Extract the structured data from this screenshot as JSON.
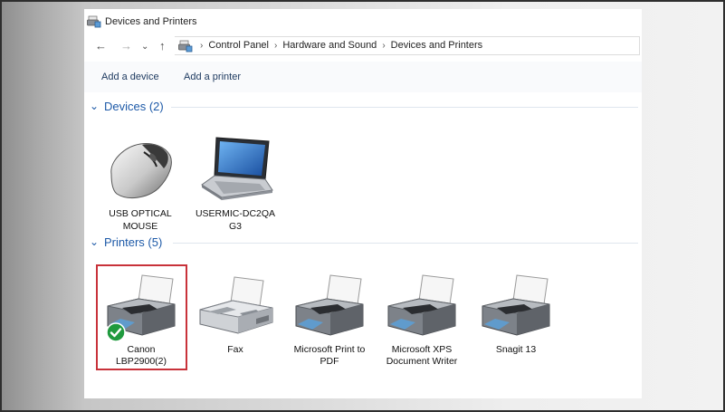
{
  "window": {
    "title": "Devices and Printers"
  },
  "nav": {
    "back": "←",
    "forward": "→",
    "recent": "⌄",
    "up": "↑"
  },
  "breadcrumb": [
    "Control Panel",
    "Hardware and Sound",
    "Devices and Printers"
  ],
  "breadcrumb_separator": "›",
  "toolbar": {
    "add_device": "Add a device",
    "add_printer": "Add a printer"
  },
  "devices_group": {
    "header": "Devices (2)",
    "items": [
      {
        "line1": "USB OPTICAL",
        "line2": "MOUSE",
        "icon": "mouse-icon"
      },
      {
        "line1": "USERMIC-DC2QA",
        "line2": "G3",
        "icon": "laptop-icon"
      }
    ]
  },
  "printers_group": {
    "header": "Printers (5)",
    "items": [
      {
        "line1": "Canon",
        "line2": "LBP2900(2)",
        "icon": "printer-icon",
        "default": true,
        "selected": true
      },
      {
        "line1": "Fax",
        "line2": "",
        "icon": "fax-icon"
      },
      {
        "line1": "Microsoft Print to",
        "line2": "PDF",
        "icon": "printer-icon"
      },
      {
        "line1": "Microsoft XPS",
        "line2": "Document Writer",
        "icon": "printer-icon"
      },
      {
        "line1": "Snagit 13",
        "line2": "",
        "icon": "printer-icon"
      }
    ]
  },
  "colors": {
    "group_header": "#1e5aa8",
    "selection_border": "#c8323a",
    "default_badge": "#1f9a3e"
  }
}
